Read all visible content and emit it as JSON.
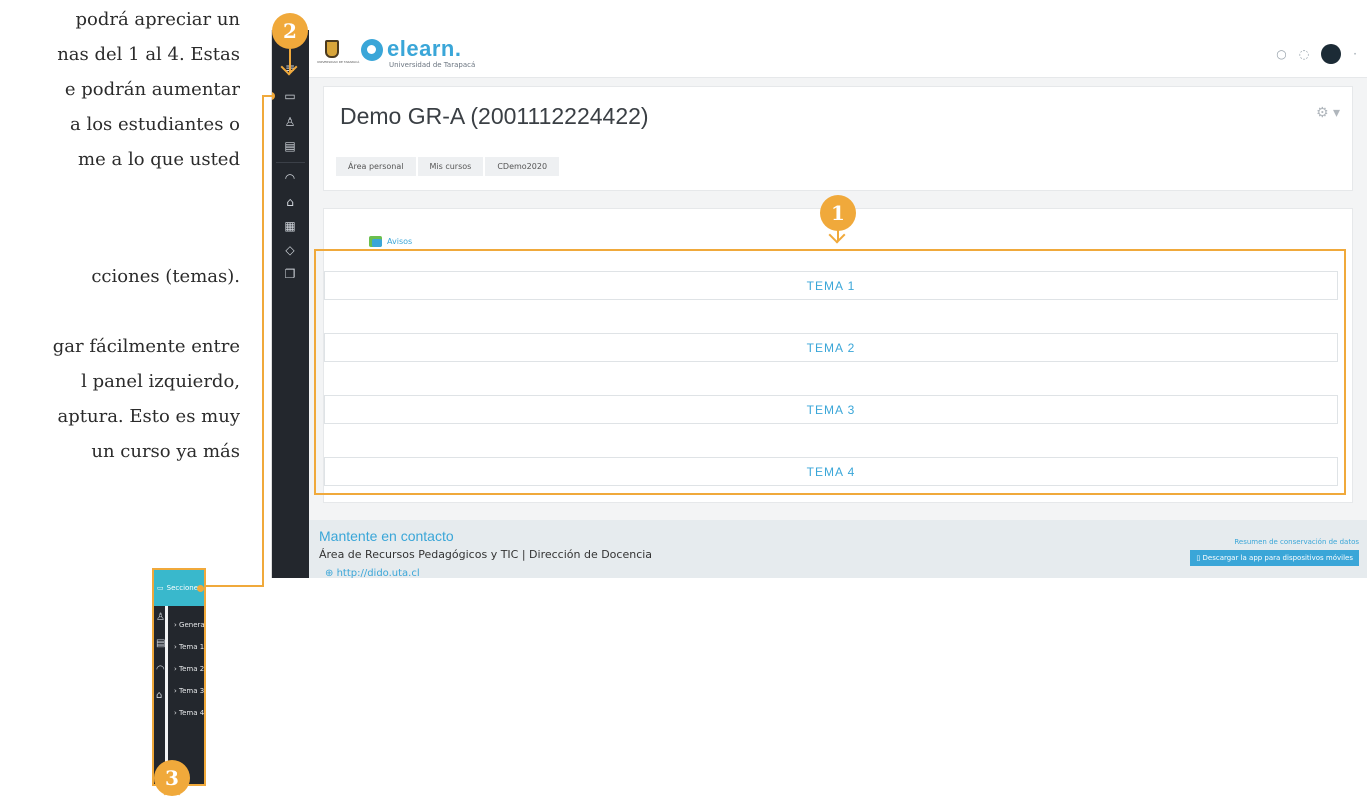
{
  "doc_text": {
    "lines": [
      "podrá apreciar un",
      "nas del 1 al 4. Estas",
      "e podrán aumentar",
      "a los estudiantes o",
      "me a lo que usted",
      "cciones (temas).",
      "gar fácilmente entre",
      "l panel izquierdo,",
      "aptura. Esto es muy",
      "un curso ya más"
    ]
  },
  "badges": {
    "one": "1",
    "two": "2",
    "three": "3"
  },
  "header": {
    "logo_text": "elearn.",
    "logo_sub": "Universidad de Tarapacá",
    "shield_caption": "UNIVERSIDAD DE TARAPACÁ"
  },
  "course": {
    "title": "Demo GR-A (2001112224422)",
    "breadcrumbs": [
      "Área personal",
      "Mis cursos",
      "CDemo2020"
    ]
  },
  "content": {
    "avisos": "Avisos",
    "topics": [
      "TEMA 1",
      "TEMA 2",
      "TEMA 3",
      "TEMA 4"
    ]
  },
  "footer": {
    "title": "Mantente en contacto",
    "subtitle": "Área de Recursos Pedagógicos y TIC | Dirección de Docencia",
    "link": "http://dido.uta.cl",
    "data_summary": "Resumen de conservación de datos",
    "app_button": "Descargar la app para dispositivos móviles"
  },
  "drawer": {
    "header": "Secciones del curso",
    "items": [
      "General",
      "Tema 1",
      "Tema 2",
      "Tema 3",
      "Tema 4"
    ]
  },
  "colors": {
    "accent": "#f0a93b",
    "brand": "#3aa6d8",
    "sidebar": "#23272d",
    "drawer_head": "#39b8cc"
  }
}
